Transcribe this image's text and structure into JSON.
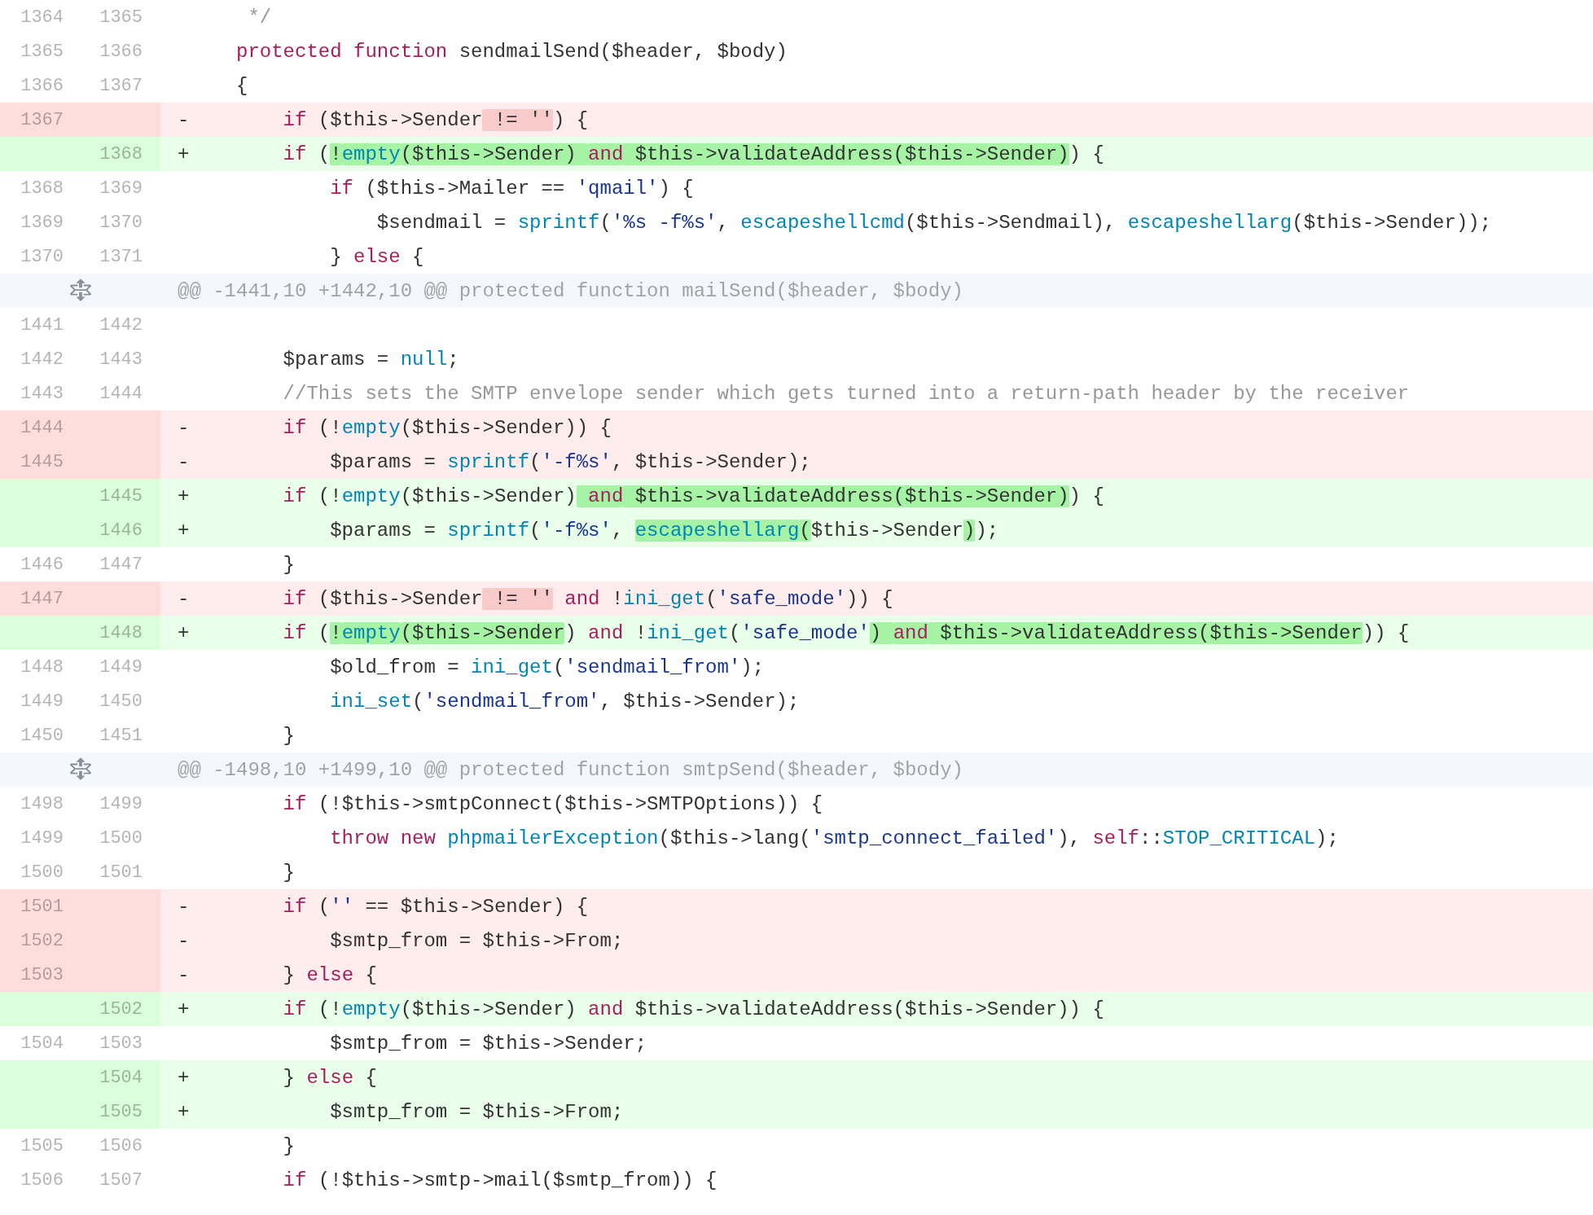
{
  "rows": [
    {
      "kind": "context",
      "old": "1364",
      "new": "1365",
      "code": [
        {
          "text": "     */",
          "kind": "comment"
        }
      ]
    },
    {
      "kind": "context",
      "old": "1365",
      "new": "1366",
      "code": [
        {
          "text": "    protected function",
          "kind": "keyword"
        },
        {
          "text": " sendmailSend",
          "kind": "entity"
        },
        {
          "text": "($header, $body)",
          "kind": "plain"
        }
      ]
    },
    {
      "kind": "context",
      "old": "1366",
      "new": "1367",
      "code": [
        {
          "text": "    {",
          "kind": "plain"
        }
      ]
    },
    {
      "kind": "del",
      "old": "1367",
      "marker": "-",
      "code": [
        {
          "text": "        if",
          "kind": "keyword",
          "changed": false
        },
        {
          "text": " ($this->Sender",
          "kind": "plain",
          "changed": false
        },
        {
          "text": " != ''",
          "kind": "plain",
          "changed": true
        },
        {
          "text": ") {",
          "kind": "plain",
          "changed": false
        }
      ]
    },
    {
      "kind": "add",
      "new": "1368",
      "marker": "+",
      "code": [
        {
          "text": "        if",
          "kind": "keyword",
          "changed": false
        },
        {
          "text": " (",
          "kind": "plain",
          "changed": false
        },
        {
          "text": "!",
          "kind": "plain",
          "changed": true
        },
        {
          "text": "empty",
          "kind": "func",
          "changed": true
        },
        {
          "text": "($this->Sender) ",
          "kind": "plain",
          "changed": true
        },
        {
          "text": "and",
          "kind": "keyword",
          "changed": true
        },
        {
          "text": " $this->validateAddress($this->Sender)",
          "kind": "plain",
          "changed": true
        },
        {
          "text": ") {",
          "kind": "plain",
          "changed": false
        }
      ]
    },
    {
      "kind": "context",
      "old": "1368",
      "new": "1369",
      "code": [
        {
          "text": "            if",
          "kind": "keyword"
        },
        {
          "text": " ($this->Mailer == ",
          "kind": "plain"
        },
        {
          "text": "'qmail'",
          "kind": "string"
        },
        {
          "text": ") {",
          "kind": "plain"
        }
      ]
    },
    {
      "kind": "context",
      "old": "1369",
      "new": "1370",
      "code": [
        {
          "text": "                $sendmail = ",
          "kind": "plain"
        },
        {
          "text": "sprintf",
          "kind": "func"
        },
        {
          "text": "(",
          "kind": "plain"
        },
        {
          "text": "'%s -f%s'",
          "kind": "string"
        },
        {
          "text": ", ",
          "kind": "plain"
        },
        {
          "text": "escapeshellcmd",
          "kind": "func"
        },
        {
          "text": "($this->Sendmail), ",
          "kind": "plain"
        },
        {
          "text": "escapeshellarg",
          "kind": "func"
        },
        {
          "text": "($this->Sender));",
          "kind": "plain"
        }
      ]
    },
    {
      "kind": "context",
      "old": "1370",
      "new": "1371",
      "code": [
        {
          "text": "            } ",
          "kind": "plain"
        },
        {
          "text": "else",
          "kind": "keyword"
        },
        {
          "text": " {",
          "kind": "plain"
        }
      ]
    },
    {
      "kind": "hunk",
      "header": "@@ -1441,10 +1442,10 @@ protected function mailSend($header, $body)"
    },
    {
      "kind": "context",
      "old": "1441",
      "new": "1442"
    },
    {
      "kind": "context",
      "old": "1442",
      "new": "1443",
      "code": [
        {
          "text": "        $params = ",
          "kind": "plain"
        },
        {
          "text": "null",
          "kind": "func"
        },
        {
          "text": ";",
          "kind": "plain"
        }
      ]
    },
    {
      "kind": "context",
      "old": "1443",
      "new": "1444",
      "code": [
        {
          "text": "        //This sets the SMTP envelope sender which gets turned into a return-path header by the receiver",
          "kind": "comment"
        }
      ]
    },
    {
      "kind": "del",
      "old": "1444",
      "marker": "-",
      "code": [
        {
          "text": "        if",
          "kind": "keyword",
          "changed": false
        },
        {
          "text": " (!",
          "kind": "plain",
          "changed": false
        },
        {
          "text": "empty",
          "kind": "func",
          "changed": false
        },
        {
          "text": "($this->Sender)) {",
          "kind": "plain",
          "changed": false
        }
      ]
    },
    {
      "kind": "del",
      "old": "1445",
      "marker": "-",
      "code": [
        {
          "text": "            $params = ",
          "kind": "plain",
          "changed": false
        },
        {
          "text": "sprintf",
          "kind": "func",
          "changed": false
        },
        {
          "text": "(",
          "kind": "plain",
          "changed": false
        },
        {
          "text": "'-f%s'",
          "kind": "string",
          "changed": false
        },
        {
          "text": ", $this->Sender);",
          "kind": "plain",
          "changed": false
        }
      ]
    },
    {
      "kind": "add",
      "new": "1445",
      "marker": "+",
      "code": [
        {
          "text": "        if",
          "kind": "keyword",
          "changed": false
        },
        {
          "text": " (!",
          "kind": "plain",
          "changed": false
        },
        {
          "text": "empty",
          "kind": "func",
          "changed": false
        },
        {
          "text": "($this->Sender)",
          "kind": "plain",
          "changed": false
        },
        {
          "text": " and",
          "kind": "keyword",
          "changed": true
        },
        {
          "text": " $this->validateAddress($this->Sender)",
          "kind": "plain",
          "changed": true
        },
        {
          "text": ") {",
          "kind": "plain",
          "changed": false
        }
      ]
    },
    {
      "kind": "add",
      "new": "1446",
      "marker": "+",
      "code": [
        {
          "text": "            $params = ",
          "kind": "plain",
          "changed": false
        },
        {
          "text": "sprintf",
          "kind": "func",
          "changed": false
        },
        {
          "text": "(",
          "kind": "plain",
          "changed": false
        },
        {
          "text": "'-f%s'",
          "kind": "string",
          "changed": false
        },
        {
          "text": ", ",
          "kind": "plain",
          "changed": false
        },
        {
          "text": "escapeshellarg",
          "kind": "func",
          "changed": true
        },
        {
          "text": "(",
          "kind": "plain",
          "changed": true
        },
        {
          "text": "$this->Sender",
          "kind": "plain",
          "changed": false
        },
        {
          "text": ")",
          "kind": "plain",
          "changed": true
        },
        {
          "text": ");",
          "kind": "plain",
          "changed": false
        }
      ]
    },
    {
      "kind": "context",
      "old": "1446",
      "new": "1447",
      "code": [
        {
          "text": "        }",
          "kind": "plain"
        }
      ]
    },
    {
      "kind": "del",
      "old": "1447",
      "marker": "-",
      "code": [
        {
          "text": "        if",
          "kind": "keyword",
          "changed": false
        },
        {
          "text": " ($this->Sender",
          "kind": "plain",
          "changed": false
        },
        {
          "text": " != ''",
          "kind": "plain",
          "changed": true
        },
        {
          "text": " and",
          "kind": "keyword",
          "changed": false
        },
        {
          "text": " !",
          "kind": "plain",
          "changed": false
        },
        {
          "text": "ini_get",
          "kind": "func",
          "changed": false
        },
        {
          "text": "(",
          "kind": "plain",
          "changed": false
        },
        {
          "text": "'safe_mode'",
          "kind": "string",
          "changed": false
        },
        {
          "text": ")) {",
          "kind": "plain",
          "changed": false
        }
      ]
    },
    {
      "kind": "add",
      "new": "1448",
      "marker": "+",
      "code": [
        {
          "text": "        if",
          "kind": "keyword",
          "changed": false
        },
        {
          "text": " (",
          "kind": "plain",
          "changed": false
        },
        {
          "text": "!",
          "kind": "plain",
          "changed": true
        },
        {
          "text": "empty",
          "kind": "func",
          "changed": true
        },
        {
          "text": "($this->Sender",
          "kind": "plain",
          "changed": true
        },
        {
          "text": ") ",
          "kind": "plain",
          "changed": false
        },
        {
          "text": "and",
          "kind": "keyword",
          "changed": false
        },
        {
          "text": " !",
          "kind": "plain",
          "changed": false
        },
        {
          "text": "ini_get",
          "kind": "func",
          "changed": false
        },
        {
          "text": "(",
          "kind": "plain",
          "changed": false
        },
        {
          "text": "'safe_mode'",
          "kind": "string",
          "changed": false
        },
        {
          "text": ") ",
          "kind": "plain",
          "changed": true
        },
        {
          "text": "and",
          "kind": "keyword",
          "changed": true
        },
        {
          "text": " $this->validateAddress($this->Sender",
          "kind": "plain",
          "changed": true
        },
        {
          "text": ")) {",
          "kind": "plain",
          "changed": false
        }
      ]
    },
    {
      "kind": "context",
      "old": "1448",
      "new": "1449",
      "code": [
        {
          "text": "            $old_from = ",
          "kind": "plain"
        },
        {
          "text": "ini_get",
          "kind": "func"
        },
        {
          "text": "(",
          "kind": "plain"
        },
        {
          "text": "'sendmail_from'",
          "kind": "string"
        },
        {
          "text": ");",
          "kind": "plain"
        }
      ]
    },
    {
      "kind": "context",
      "old": "1449",
      "new": "1450",
      "code": [
        {
          "text": "            ini_set",
          "kind": "func"
        },
        {
          "text": "(",
          "kind": "plain"
        },
        {
          "text": "'sendmail_from'",
          "kind": "string"
        },
        {
          "text": ", $this->Sender);",
          "kind": "plain"
        }
      ]
    },
    {
      "kind": "context",
      "old": "1450",
      "new": "1451",
      "code": [
        {
          "text": "        }",
          "kind": "plain"
        }
      ]
    },
    {
      "kind": "hunk",
      "header": "@@ -1498,10 +1499,10 @@ protected function smtpSend($header, $body)"
    },
    {
      "kind": "context",
      "old": "1498",
      "new": "1499",
      "code": [
        {
          "text": "        if",
          "kind": "keyword"
        },
        {
          "text": " (!$this->smtpConnect($this->SMTPOptions)) {",
          "kind": "plain"
        }
      ]
    },
    {
      "kind": "context",
      "old": "1499",
      "new": "1500",
      "code": [
        {
          "text": "            throw new",
          "kind": "keyword"
        },
        {
          "text": " phpmailerException",
          "kind": "func"
        },
        {
          "text": "($this->lang(",
          "kind": "plain"
        },
        {
          "text": "'smtp_connect_failed'",
          "kind": "string"
        },
        {
          "text": "), ",
          "kind": "plain"
        },
        {
          "text": "self",
          "kind": "keyword"
        },
        {
          "text": "::",
          "kind": "plain"
        },
        {
          "text": "STOP_CRITICAL",
          "kind": "func"
        },
        {
          "text": ");",
          "kind": "plain"
        }
      ]
    },
    {
      "kind": "context",
      "old": "1500",
      "new": "1501",
      "code": [
        {
          "text": "        }",
          "kind": "plain"
        }
      ]
    },
    {
      "kind": "del",
      "old": "1501",
      "marker": "-",
      "code": [
        {
          "text": "        if",
          "kind": "keyword",
          "changed": false
        },
        {
          "text": " (",
          "kind": "plain",
          "changed": false
        },
        {
          "text": "''",
          "kind": "string",
          "changed": false
        },
        {
          "text": " == $this->Sender) {",
          "kind": "plain",
          "changed": false
        }
      ]
    },
    {
      "kind": "del",
      "old": "1502",
      "marker": "-",
      "code": [
        {
          "text": "            $smtp_from = $this->From;",
          "kind": "plain",
          "changed": false
        }
      ]
    },
    {
      "kind": "del",
      "old": "1503",
      "marker": "-",
      "code": [
        {
          "text": "        } ",
          "kind": "plain",
          "changed": false
        },
        {
          "text": "else",
          "kind": "keyword",
          "changed": false
        },
        {
          "text": " {",
          "kind": "plain",
          "changed": false
        }
      ]
    },
    {
      "kind": "add",
      "new": "1502",
      "marker": "+",
      "code": [
        {
          "text": "        if",
          "kind": "keyword",
          "changed": false
        },
        {
          "text": " (!",
          "kind": "plain",
          "changed": false
        },
        {
          "text": "empty",
          "kind": "func",
          "changed": false
        },
        {
          "text": "($this->Sender) ",
          "kind": "plain",
          "changed": false
        },
        {
          "text": "and",
          "kind": "keyword",
          "changed": false
        },
        {
          "text": " $this->validateAddress($this->Sender)) {",
          "kind": "plain",
          "changed": false
        }
      ]
    },
    {
      "kind": "context",
      "old": "1504",
      "new": "1503",
      "code": [
        {
          "text": "            $smtp_from = $this->Sender;",
          "kind": "plain"
        }
      ]
    },
    {
      "kind": "add",
      "new": "1504",
      "marker": "+",
      "code": [
        {
          "text": "        } ",
          "kind": "plain",
          "changed": false
        },
        {
          "text": "else",
          "kind": "keyword",
          "changed": false
        },
        {
          "text": " {",
          "kind": "plain",
          "changed": false
        }
      ]
    },
    {
      "kind": "add",
      "new": "1505",
      "marker": "+",
      "code": [
        {
          "text": "            $smtp_from = $this->From;",
          "kind": "plain",
          "changed": false
        }
      ]
    },
    {
      "kind": "context",
      "old": "1505",
      "new": "1506",
      "code": [
        {
          "text": "        }",
          "kind": "plain"
        }
      ]
    },
    {
      "kind": "context",
      "old": "1506",
      "new": "1507",
      "code": [
        {
          "text": "        if",
          "kind": "keyword"
        },
        {
          "text": " (!$this->smtp->mail($smtp_from)) {",
          "kind": "plain"
        }
      ]
    }
  ]
}
